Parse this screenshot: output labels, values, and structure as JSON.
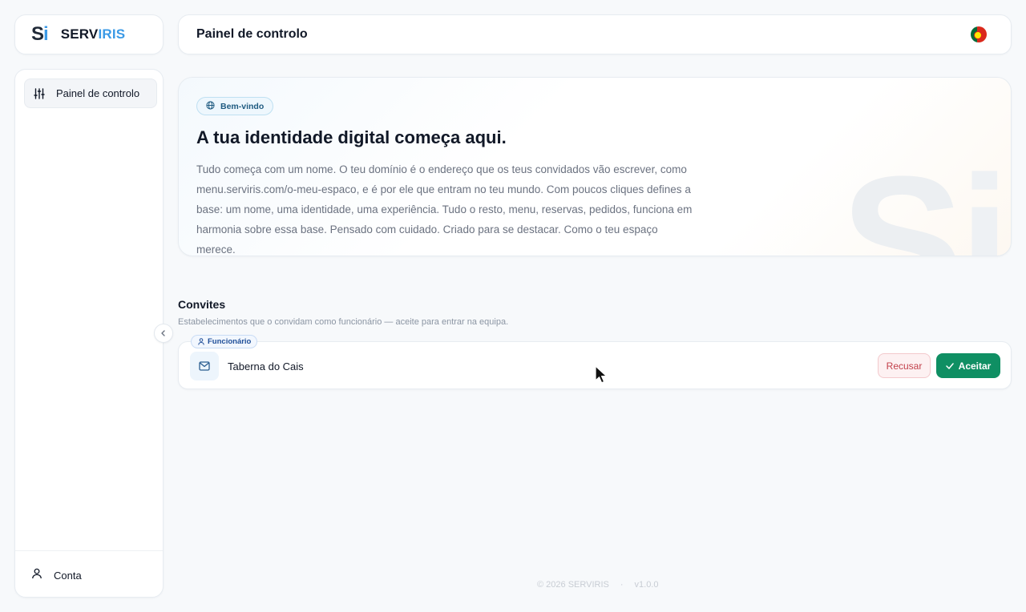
{
  "brand": {
    "mark_s": "S",
    "mark_i": "i",
    "name_part1": "SERV",
    "name_part2": "IRIS"
  },
  "header": {
    "title": "Painel de controlo",
    "language_flag": "portugal-flag-icon"
  },
  "sidebar": {
    "items": [
      {
        "label": "Painel de controlo",
        "icon": "sliders-icon",
        "active": true
      }
    ],
    "account_label": "Conta"
  },
  "hero": {
    "badge": "Bem-vindo",
    "title": "A tua identidade digital começa aqui.",
    "text": "Tudo começa com um nome. O teu domínio é o endereço que os teus convidados vão escrever, como menu.serviris.com/o-meu-espaco, e é por ele que entram no teu mundo. Com poucos cliques defines a base: um nome, uma identidade, uma experiência. Tudo o resto, menu, reservas, pedidos, funciona em harmonia sobre essa base. Pensado com cuidado. Criado para se destacar. Como o teu espaço merece.",
    "watermark_s": "S",
    "watermark_i": "i"
  },
  "invites": {
    "title": "Convites",
    "subtitle": "Estabelecimentos que o convidam como funcionário — aceite para entrar na equipa.",
    "items": [
      {
        "role": "Funcionário",
        "name": "Taberna do Cais",
        "reject_label": "Recusar",
        "accept_label": "Aceitar"
      }
    ]
  },
  "footer": {
    "copyright": "© 2026 SERVIRIS",
    "separator": "·",
    "version": "v1.0.0"
  },
  "colors": {
    "accent": "#3b9ae6",
    "accept": "#0f8f63",
    "reject": "#c2414b"
  }
}
